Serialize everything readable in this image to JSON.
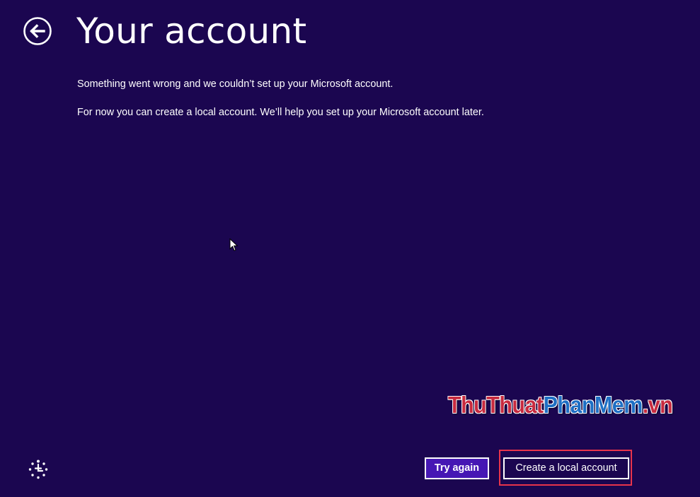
{
  "header": {
    "title": "Your account",
    "back_icon": "back-arrow-icon"
  },
  "content": {
    "message_1": "Something went wrong and we couldn’t set up your Microsoft account.",
    "message_2": "For now you can create a local account. We’ll help you set up your Microsoft account later."
  },
  "footer": {
    "ease_of_access_icon": "ease-of-access-icon",
    "try_again_label": "Try again",
    "create_local_label": "Create a local account"
  },
  "watermark": {
    "part1": "ThuThuat",
    "part2": "PhanMem",
    "part3": ".vn"
  },
  "colors": {
    "background": "#1b0650",
    "primary_button": "#4617b4",
    "highlight_border": "#e8344b",
    "text": "#ffffff"
  }
}
